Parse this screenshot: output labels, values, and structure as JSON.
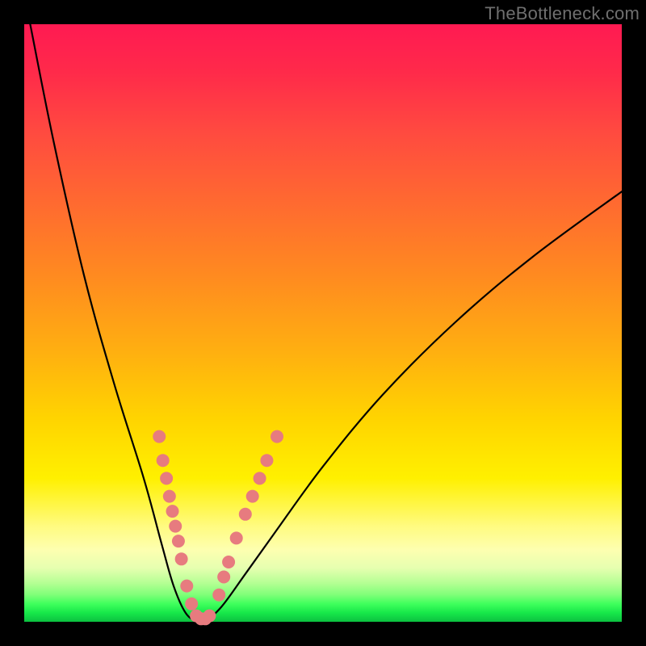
{
  "watermark": "TheBottleneck.com",
  "chart_data": {
    "type": "line",
    "title": "",
    "xlabel": "",
    "ylabel": "",
    "xlim": [
      0,
      100
    ],
    "ylim": [
      0,
      100
    ],
    "grid": false,
    "legend": false,
    "series": [
      {
        "name": "bottleneck-curve",
        "x": [
          1,
          5,
          10,
          15,
          20,
          23,
          25,
          27,
          28.8,
          30.3,
          33,
          37,
          42,
          50,
          60,
          72,
          85,
          100
        ],
        "y": [
          100,
          80,
          58,
          40,
          24,
          13,
          6,
          1.5,
          0.2,
          0.2,
          2.5,
          8,
          15,
          26,
          38,
          50,
          61,
          72
        ]
      }
    ],
    "markers": {
      "name": "highlight-dots",
      "color": "#e77b7f",
      "radius_px": 8,
      "points": [
        {
          "x": 22.6,
          "y": 31.0
        },
        {
          "x": 23.2,
          "y": 27.0
        },
        {
          "x": 23.8,
          "y": 24.0
        },
        {
          "x": 24.3,
          "y": 21.0
        },
        {
          "x": 24.8,
          "y": 18.5
        },
        {
          "x": 25.3,
          "y": 16.0
        },
        {
          "x": 25.8,
          "y": 13.5
        },
        {
          "x": 26.3,
          "y": 10.5
        },
        {
          "x": 27.2,
          "y": 6.0
        },
        {
          "x": 28.0,
          "y": 3.0
        },
        {
          "x": 28.8,
          "y": 1.0
        },
        {
          "x": 29.6,
          "y": 0.5
        },
        {
          "x": 30.3,
          "y": 0.5
        },
        {
          "x": 31.0,
          "y": 1.0
        },
        {
          "x": 32.6,
          "y": 4.5
        },
        {
          "x": 33.4,
          "y": 7.5
        },
        {
          "x": 34.2,
          "y": 10.0
        },
        {
          "x": 35.5,
          "y": 14.0
        },
        {
          "x": 37.0,
          "y": 18.0
        },
        {
          "x": 38.2,
          "y": 21.0
        },
        {
          "x": 39.4,
          "y": 24.0
        },
        {
          "x": 40.6,
          "y": 27.0
        },
        {
          "x": 42.3,
          "y": 31.0
        }
      ]
    }
  }
}
